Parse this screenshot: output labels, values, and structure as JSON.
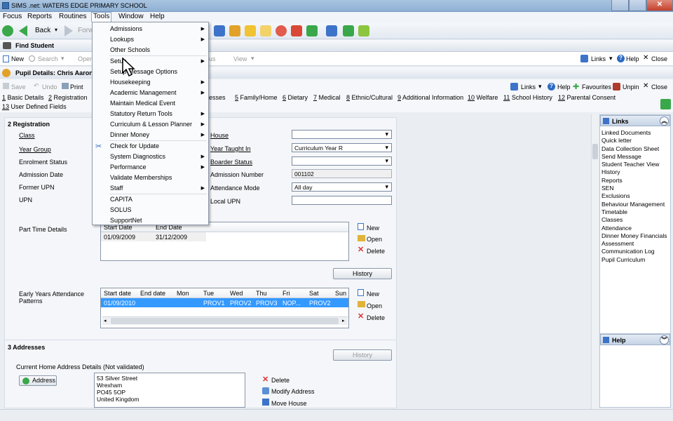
{
  "window": {
    "title": "SIMS .net: WATERS EDGE PRIMARY SCHOOL"
  },
  "menubar": {
    "items": [
      "Focus",
      "Reports",
      "Routines",
      "Tools",
      "Window",
      "Help"
    ]
  },
  "toolbar": {
    "back": "Back",
    "forward": "Forw"
  },
  "find": {
    "title": "Find Student",
    "new": "New",
    "search": "Search",
    "open": "Open",
    "status": "us",
    "view": "View",
    "links": "Links",
    "help": "Help",
    "close": "Close"
  },
  "pupil": {
    "title": "Pupil Details: Chris Aaron",
    "save": "Save",
    "undo": "Undo",
    "print": "Print",
    "links": "Links",
    "help": "Help",
    "favourites": "Favourites",
    "unpin": "Unpin",
    "close": "Close"
  },
  "sections": {
    "row1": [
      {
        "n": "1",
        "label": "Basic Details"
      },
      {
        "n": "2",
        "label": "Registration"
      },
      {
        "n": "",
        "label": "esses"
      },
      {
        "n": "5",
        "label": "Family/Home"
      },
      {
        "n": "6",
        "label": "Dietary"
      },
      {
        "n": "7",
        "label": "Medical"
      },
      {
        "n": "8",
        "label": "Ethnic/Cultural"
      },
      {
        "n": "9",
        "label": "Additional Information"
      },
      {
        "n": "10",
        "label": "Welfare"
      },
      {
        "n": "11",
        "label": "School History"
      },
      {
        "n": "12",
        "label": "Parental Consent"
      }
    ],
    "row2": [
      {
        "n": "13",
        "label": "User Defined Fields"
      }
    ]
  },
  "registration": {
    "title": "2 Registration",
    "class": "Class",
    "year_group": "Year Group",
    "enrolment_status": "Enrolment Status",
    "admission_date": "Admission Date",
    "former_upn": "Former UPN",
    "upn": "UPN",
    "house": "House",
    "year_taught_in": "Year Taught In",
    "year_taught_in_value": "Curriculum Year  R",
    "boarder_status": "Boarder Status",
    "admission_number": "Admission Number",
    "admission_number_value": "001102",
    "attendance_mode": "Attendance Mode",
    "attendance_mode_value": "All day",
    "local_upn": "Local UPN",
    "part_time_details": "Part Time Details",
    "pt_headers": [
      "Start Date",
      "End Date"
    ],
    "pt_row": [
      "01/09/2009",
      "31/12/2009"
    ],
    "new": "New",
    "open": "Open",
    "delete": "Delete",
    "history": "History",
    "eyap_label": "Early Years Attendance Patterns",
    "eyap_headers": [
      "Start date",
      "End date",
      "Mon",
      "Tue",
      "Wed",
      "Thu",
      "Fri",
      "Sat",
      "Sun"
    ],
    "eyap_row": [
      "01/09/2010",
      "",
      "PROV1",
      "PROV2",
      "PROV3",
      "NOP...",
      "PROV2",
      "",
      ""
    ]
  },
  "addresses": {
    "title": "3 Addresses",
    "history": "History",
    "current": "Current Home Address Details (Not validated)",
    "address_button": "Address",
    "address_lines": [
      "53 Silver Street",
      "Wrexham",
      "PO45 5OP",
      "United Kingdom"
    ],
    "delete": "Delete",
    "modify": "Modify Address",
    "move": "Move House"
  },
  "links_panel": {
    "title": "Links",
    "items": [
      "Linked Documents",
      "Quick letter",
      "Data Collection Sheet",
      "Send Message",
      "Student Teacher View",
      "History",
      "Reports",
      "SEN",
      "Exclusions",
      "Behaviour Management",
      "Timetable",
      "Classes",
      "Attendance",
      "Dinner Money Financials",
      "Assessment",
      "Communication Log",
      "Pupil Curriculum"
    ]
  },
  "help_panel": {
    "title": "Help"
  },
  "tools_menu": {
    "items": [
      {
        "label": "Admissions",
        "sub": true
      },
      {
        "label": "Lookups",
        "sub": true
      },
      {
        "label": "Other Schools",
        "sub": false
      },
      {
        "label": "Setup",
        "sub": true
      },
      {
        "label": "Setup Message Options",
        "sub": false
      },
      {
        "label": "Housekeeping",
        "sub": true
      },
      {
        "label": "Academic Management",
        "sub": true
      },
      {
        "label": "Maintain Medical Event",
        "sub": false
      },
      {
        "label": "Statutory Return Tools",
        "sub": true
      },
      {
        "label": "Curriculum & Lesson Planner",
        "sub": true
      },
      {
        "label": "Dinner Money",
        "sub": true
      },
      {
        "label": "Check for Update",
        "sub": false
      },
      {
        "label": "System Diagnostics",
        "sub": true
      },
      {
        "label": "Performance",
        "sub": true
      },
      {
        "label": "Validate Memberships",
        "sub": false
      },
      {
        "label": "Staff",
        "sub": true
      },
      {
        "label": "CAPITA",
        "sub": false
      },
      {
        "label": "SOLUS",
        "sub": false
      },
      {
        "label": "SupportNet",
        "sub": false
      }
    ]
  },
  "colors": {
    "accent": "#1e5fb4",
    "selection": "#3399ff",
    "menu_bg": "#fafbfc"
  }
}
